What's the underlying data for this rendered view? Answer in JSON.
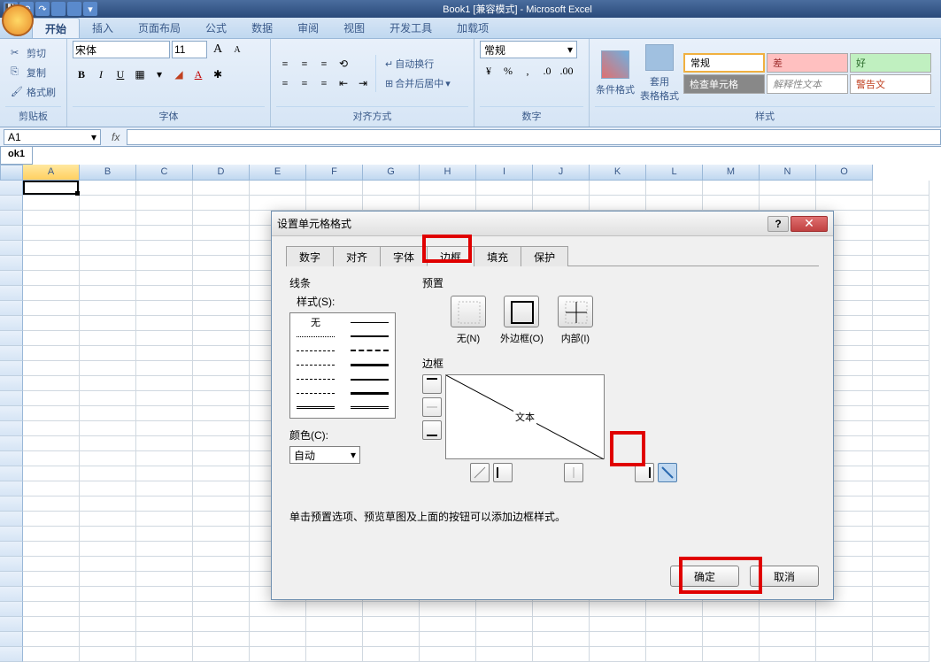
{
  "app": {
    "title": "Book1 [兼容模式] - Microsoft Excel"
  },
  "ribbon": {
    "tabs": [
      "开始",
      "插入",
      "页面布局",
      "公式",
      "数据",
      "审阅",
      "视图",
      "开发工具",
      "加载项"
    ],
    "active_tab": "开始",
    "groups": {
      "clipboard": {
        "label": "剪贴板",
        "cut": "剪切",
        "copy": "复制",
        "painter": "格式刷"
      },
      "font": {
        "label": "字体",
        "name": "宋体",
        "size": "11"
      },
      "alignment": {
        "label": "对齐方式",
        "wrap": "自动换行",
        "merge": "合并后居中"
      },
      "number": {
        "label": "数字",
        "format": "常规"
      },
      "styles": {
        "label": "样式",
        "conditional": "条件格式",
        "table": "套用\n表格格式",
        "items": [
          "常规",
          "差",
          "好",
          "检查单元格",
          "解释性文本",
          "警告文"
        ]
      }
    }
  },
  "formula_bar": {
    "cell_ref": "A1",
    "fx": "fx"
  },
  "sheet_tab": "ok1",
  "columns": [
    "A",
    "B",
    "C",
    "D",
    "E",
    "F",
    "G",
    "H",
    "I",
    "J",
    "K",
    "L",
    "M",
    "N",
    "O"
  ],
  "dialog": {
    "title": "设置单元格格式",
    "help": "?",
    "close": "✕",
    "tabs": [
      "数字",
      "对齐",
      "字体",
      "边框",
      "填充",
      "保护"
    ],
    "active_tab": "边框",
    "line": {
      "label": "线条",
      "style_label": "样式(S):",
      "none": "无",
      "color_label": "颜色(C):",
      "color_value": "自动"
    },
    "preset": {
      "label": "预置",
      "none": "无(N)",
      "outline": "外边框(O)",
      "inside": "内部(I)"
    },
    "border": {
      "label": "边框",
      "text": "文本"
    },
    "help_text": "单击预置选项、预览草图及上面的按钮可以添加边框样式。",
    "ok": "确定",
    "cancel": "取消"
  }
}
